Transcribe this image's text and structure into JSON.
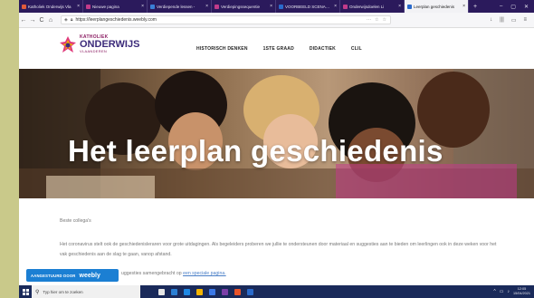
{
  "browser": {
    "tabs": [
      {
        "title": "Katholiek Onderwijs Vla",
        "color": "#e05a3a",
        "active": false
      },
      {
        "title": "Nieuwe pagina",
        "color": "#c23b8a",
        "active": false
      },
      {
        "title": "Verdiepende lessen - ",
        "color": "#3a7fd6",
        "active": false
      },
      {
        "title": "Verdiepingssequentie",
        "color": "#c23b8a",
        "active": false
      },
      {
        "title": "VOORBEELD SCENARIO",
        "color": "#2a6acb",
        "active": false
      },
      {
        "title": "Onderwijsdoelen Li",
        "color": "#c23b8a",
        "active": false
      },
      {
        "title": "Leerplan geschiedenis",
        "color": "#2a6acb",
        "active": true
      }
    ],
    "new_tab": "+",
    "close": "×",
    "url": "https://leerplangeschiedenis.weebly.com",
    "window_controls": [
      "–",
      "▢",
      "✕"
    ],
    "nav": {
      "back": "←",
      "forward": "→",
      "reload": "C",
      "home": "⌂"
    },
    "url_extras": [
      "···",
      "☆",
      "☆"
    ],
    "toolbar_icons": [
      "↓",
      "|||",
      "▭",
      "≡"
    ]
  },
  "site": {
    "logo": {
      "line1": "KATHOLIEK",
      "line2": "ONDERWIJS",
      "line3": "VLAANDEREN"
    },
    "menu": [
      "HISTORISCH DENKEN",
      "1STE GRAAD",
      "DIDACTIEK",
      "CLIL"
    ],
    "hero_title": "Het leerplan geschiedenis",
    "greeting": "Beste collega's",
    "intro": "Het coronavirus stelt ook de geschiedenisleraren voor grote uitdagingen. Als begeleiders proberen we jullie te ondersteunen door materiaal en suggesties aan te bieden om leerlingen ook in deze weken voor het vak geschiedenis aan de slag te gaan, vanop afstand.",
    "more_prefix": "uggesties samengebracht op ",
    "more_link": "een speciale pagina.",
    "badge_text": "AANGESTUURD DOOR",
    "badge_brand": "weebly"
  },
  "taskbar": {
    "search_placeholder": "Typ hier om te zoeken",
    "search_icon": "⚲",
    "apps": [
      "#e6e6e6",
      "#2a7fd4",
      "#1e88e5",
      "#f4b400",
      "#3b78e7",
      "#7b3fa8",
      "#e8542a",
      "#2a6acb"
    ],
    "time": "12:05",
    "date": "15/04/2021",
    "tray_icons": [
      "^",
      "▭",
      "♪"
    ]
  }
}
